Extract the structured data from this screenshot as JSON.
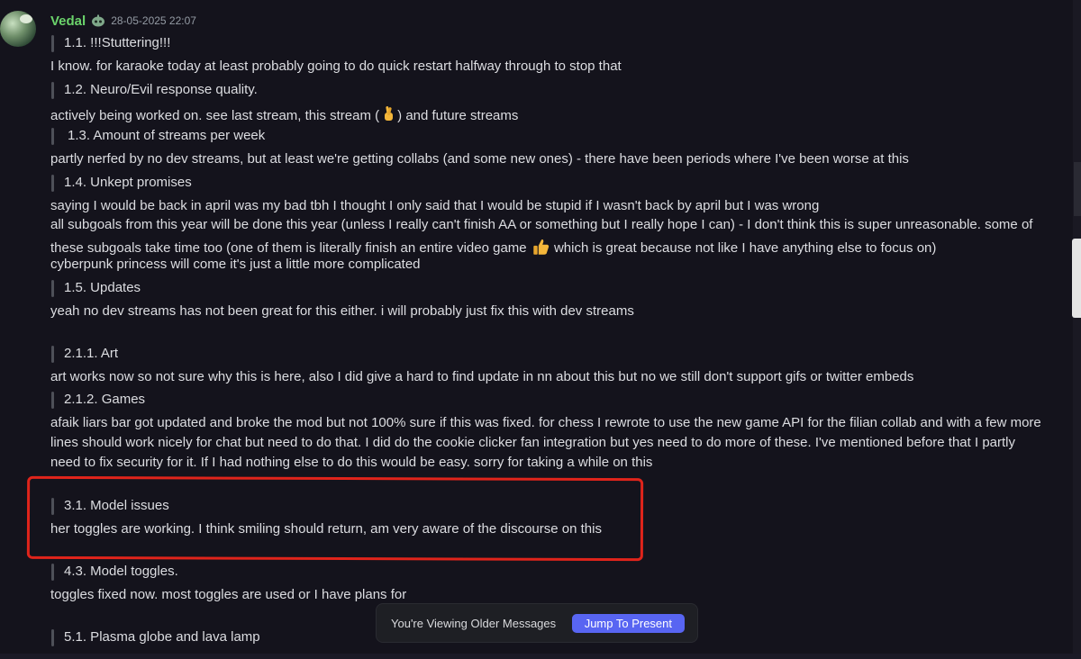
{
  "message": {
    "username": "Vedal",
    "timestamp": "28-05-2025 22:07"
  },
  "sections": {
    "q1_1": "1.1. !!!Stuttering!!!",
    "a1_1": "I know. for karaoke today at least probably going to do quick restart halfway through to stop that",
    "q1_2": "1.2. Neuro/Evil response quality.",
    "a1_2_before": "actively being worked on. see last stream, this stream (",
    "a1_2_after": ") and future streams",
    "q1_3": "1.3. Amount of streams per week",
    "a1_3": "partly nerfed by no dev streams, but at least we're getting collabs (and some new ones) - there have been periods where I've been worse at this",
    "q1_4": "1.4. Unkept promises",
    "a1_4_l1": "saying I would be back in april was my bad tbh I thought I only said that I would be stupid if I wasn't back by april but I was wrong",
    "a1_4_l2": "all subgoals from this year will be done this year (unless I really can't finish AA or something but I really hope I can) - I don't think this is super unreasonable. some of",
    "a1_4_l3_before": "these subgoals take time too (one of them is literally finish an entire video game",
    "a1_4_l3_after": "which is great because not like I have anything else to focus on)",
    "a1_4_l4": "cyberpunk princess will come it's just a little more complicated",
    "q1_5": "1.5. Updates",
    "a1_5": "yeah no dev streams has not been great for this either. i will probably just fix this with dev streams",
    "q2_1_1": "2.1.1. Art",
    "a2_1_1": "art works now so not sure why this is here, also I did give a hard to find update in nn about this but no we still don't support gifs or twitter embeds",
    "q2_1_2": "2.1.2. Games",
    "a2_1_2_l1": "afaik liars bar got updated and broke the mod but not 100% sure if this was fixed. for chess I rewrote to use the new game API for the filian collab and with a few more",
    "a2_1_2_l2": "lines should work nicely for chat but need to do that. I did do the cookie clicker fan integration but yes need to do more of these. I've mentioned before that I partly",
    "a2_1_2_l3": "need to fix security for it. If I had nothing else to do this would be easy. sorry for taking a while on this",
    "q3_1": "3.1. Model issues",
    "a3_1": "her toggles are working. I think smiling should return, am very aware of the discourse on this",
    "q4_3": "4.3. Model toggles.",
    "a4_3": "toggles fixed now. most toggles are used or I have plans for",
    "q5_1": "5.1. Plasma globe and lava lamp"
  },
  "older_messages_bar": {
    "text": "You're Viewing Older Messages",
    "button": "Jump To Present"
  },
  "colors": {
    "background": "#14131c",
    "username": "#6bd36b",
    "accent": "#5865f2",
    "highlight": "#e0241b"
  },
  "icons": [
    "bot-icon",
    "crossed-fingers-emoji",
    "thumbs-up-emoji"
  ]
}
